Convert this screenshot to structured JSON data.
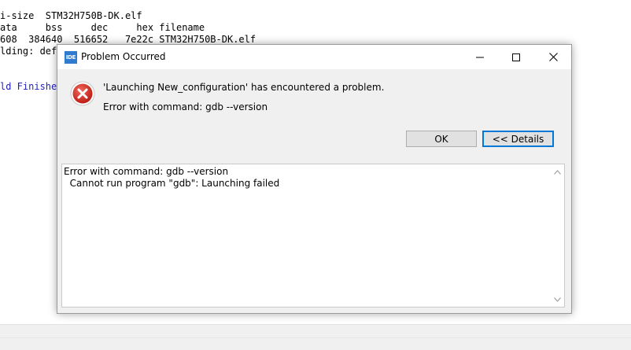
{
  "console": {
    "lines": [
      "i-size  STM32H750B-DK.elf",
      "ata     bss     dec     hex filename",
      "608  384640  516652   7e22c STM32H750B-DK.elf",
      "lding: defa",
      "",
      "ld Finished"
    ]
  },
  "dialog": {
    "app_icon_text": "IDE",
    "title": "Problem Occurred",
    "message": "'Launching New_configuration' has encountered a problem.",
    "detail": "Error with command: gdb --version",
    "ok_label": "OK",
    "details_label": "<< Details",
    "details_text": "Error with command: gdb --version\n  Cannot run program \"gdb\": Launching failed"
  },
  "colors": {
    "error_red": "#d9211d",
    "accent_blue": "#0078d7",
    "console_blue": "#1f1fbf"
  },
  "icons": [
    "ide-app-icon",
    "minimize-icon",
    "maximize-icon",
    "close-icon",
    "error-icon",
    "scroll-up-icon",
    "scroll-down-icon"
  ]
}
